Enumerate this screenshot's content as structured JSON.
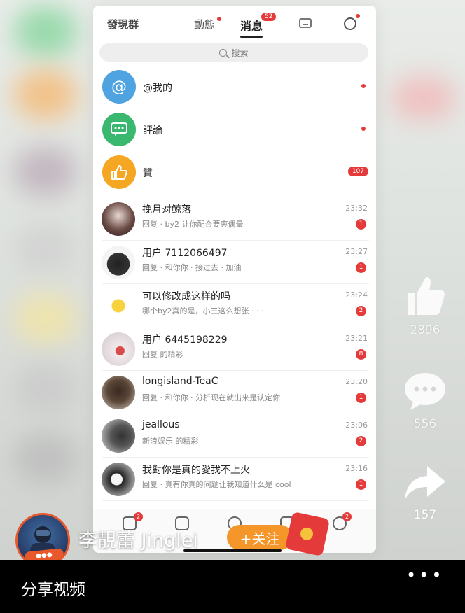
{
  "phone": {
    "tabs": {
      "discover": "發現群",
      "follow": "動態",
      "messages": "消息",
      "messages_badge": "52"
    },
    "search_placeholder": "搜索",
    "system_rows": [
      {
        "label": "@我的",
        "icon": "at-icon",
        "color": "#4ea3e0",
        "indicator": "dot"
      },
      {
        "label": "評論",
        "icon": "chat-bubble-icon",
        "color": "#3bb86f",
        "indicator": "dot"
      },
      {
        "label": "贊",
        "icon": "thumbs-up-icon",
        "color": "#f5a623",
        "indicator": "pill",
        "pill": "107"
      }
    ],
    "chats": [
      {
        "name": "挽月对鲸落",
        "preview": "回复 · by2 让你配合要爽偶最",
        "time": "23:32",
        "badge": "1"
      },
      {
        "name": "用户 7112066497",
        "preview": "回复 · 和你你 · 接过去 · 加油",
        "time": "23:27",
        "badge": "1"
      },
      {
        "name": "可以修改成这样的吗",
        "preview": "哪个by2真的是，小三这么想张 · · ·",
        "time": "23:24",
        "badge": "2"
      },
      {
        "name": "用户 6445198229",
        "preview": "回复 的精彩",
        "time": "23:21",
        "badge": "8"
      },
      {
        "name": "longisland-TeaC",
        "preview": "回复 · 和你你 · 分析现在就出来是认定你",
        "time": "23:20",
        "badge": "1"
      },
      {
        "name": "jeallous",
        "preview": "新浪娱乐 的精彩",
        "time": "23:06",
        "badge": "2"
      },
      {
        "name": "我對你是真的愛我不上火",
        "preview": "回复 · 真有你真的问题让我知道什么是 cool",
        "time": "23:16",
        "badge": "1"
      }
    ],
    "nav_badges": [
      "2",
      "2"
    ]
  },
  "rail": {
    "likes": "2896",
    "comments": "556",
    "shares": "157"
  },
  "creator": {
    "name": "李靚蕾 Jinglei",
    "follow_label": "+关注"
  },
  "bottom": {
    "share_label": "分享视频",
    "more": "•••"
  }
}
